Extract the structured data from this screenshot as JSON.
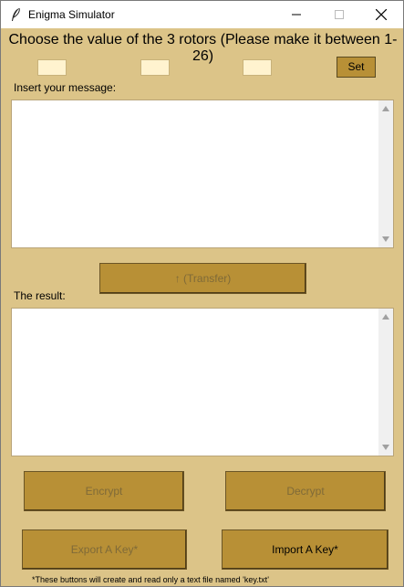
{
  "window": {
    "title": "Enigma Simulator"
  },
  "heading": "Choose the value of the 3 rotors (Please make it between 1-26)",
  "rotors": [
    {
      "value": ""
    },
    {
      "value": ""
    },
    {
      "value": ""
    }
  ],
  "set_button": "Set",
  "message_label": "Insert your message:",
  "message_text": "",
  "transfer_button": "↑ (Transfer)",
  "result_label": "The result:",
  "result_text": "",
  "encrypt_button": "Encrypt",
  "decrypt_button": "Decrypt",
  "export_button": "Export A Key*",
  "import_button": "Import A Key*",
  "footnote": "*These buttons will create and read only a text file named 'key.txt'",
  "colors": {
    "background": "#dcc488",
    "button": "#b89036",
    "entry": "#fff3cf"
  }
}
